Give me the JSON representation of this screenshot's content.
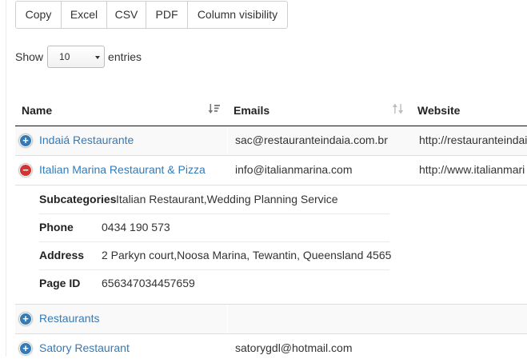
{
  "toolbar": {
    "copy": "Copy",
    "excel": "Excel",
    "csv": "CSV",
    "pdf": "PDF",
    "column_visibility": "Column visibility"
  },
  "length_menu": {
    "show_label": "Show",
    "selected": "10",
    "entries_label": "entries"
  },
  "table": {
    "columns": [
      "Name",
      "Emails",
      "Website"
    ],
    "rows": [
      {
        "name": "Indaiá Restaurante",
        "email": "sac@restauranteindaia.com.br",
        "website": "http://restauranteindaia",
        "expanded": false
      },
      {
        "name": "Italian Marina Restaurant & Pizza",
        "email": "info@italianmarina.com",
        "website": "http://www.italianmari",
        "expanded": true,
        "details": [
          {
            "label": "Subcategories",
            "value": "Italian Restaurant,Wedding Planning Service"
          },
          {
            "label": "Phone",
            "value": "0434 190 573"
          },
          {
            "label": "Address",
            "value": "2 Parkyn court,Noosa Marina, Tewantin, Queensland 4565"
          },
          {
            "label": "Page ID",
            "value": "656347034457659"
          }
        ]
      },
      {
        "name": "Restaurants",
        "email": "",
        "website": "",
        "expanded": false
      },
      {
        "name": "Satory Restaurant",
        "email": "satorygdl@hotmail.com",
        "website": "",
        "expanded": false
      }
    ]
  },
  "colors": {
    "link": "#337ab7",
    "expand_toggle": "#337ab7",
    "collapse_toggle": "#d33333",
    "header_rule": "#111111"
  }
}
